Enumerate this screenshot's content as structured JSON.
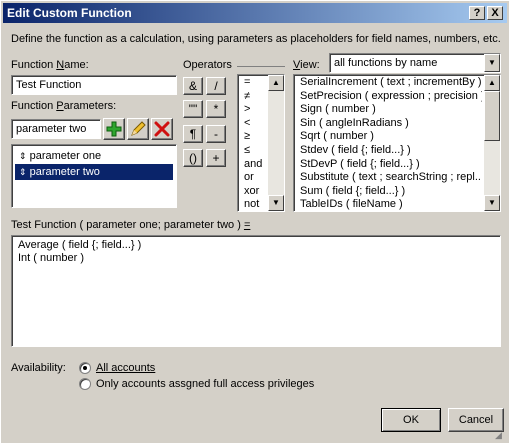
{
  "window": {
    "title": "Edit Custom Function",
    "help_label": "?",
    "close_label": "X"
  },
  "description": "Define the function as a calculation, using parameters as placeholders for field names, numbers, etc.",
  "function_name": {
    "label_pre": "Function ",
    "label_u": "N",
    "label_post": "ame:",
    "value": "Test Function"
  },
  "function_parameters": {
    "label_pre": "Function ",
    "label_u": "P",
    "label_post": "arameters:",
    "input_value": "parameter two",
    "items": [
      "parameter one",
      "parameter two"
    ],
    "selected_index": 1
  },
  "operators": {
    "label": "Operators",
    "buttons": [
      "&",
      "/",
      "\"\"",
      "*",
      "¶",
      "-",
      "()",
      "+"
    ],
    "list": [
      "=",
      "≠",
      ">",
      "<",
      "≥",
      "≤",
      "and",
      "or",
      "xor",
      "not"
    ]
  },
  "view": {
    "label_u": "V",
    "label_post": "iew:",
    "selected": "all functions by name",
    "functions": [
      "SerialIncrement ( text ; incrementBy )",
      "SetPrecision ( expression ; precision )",
      "Sign ( number )",
      "Sin ( angleInRadians )",
      "Sqrt ( number )",
      "Stdev ( field {; field...} )",
      "StDevP ( field {; field...} )",
      "Substitute ( text ; searchString ; repl...",
      "Sum ( field {; field...} )",
      "TableIDs ( fileName )"
    ]
  },
  "calculation": {
    "header": "Test Function ( parameter one; parameter two ) ",
    "header_op": "=",
    "lines": [
      "Average ( field {; field...} )",
      "Int ( number )"
    ]
  },
  "availability": {
    "label": "Availability:",
    "options": [
      "All accounts",
      "Only accounts assgned full access privileges"
    ],
    "selected_index": 0
  },
  "buttons": {
    "ok": "OK",
    "cancel": "Cancel"
  }
}
